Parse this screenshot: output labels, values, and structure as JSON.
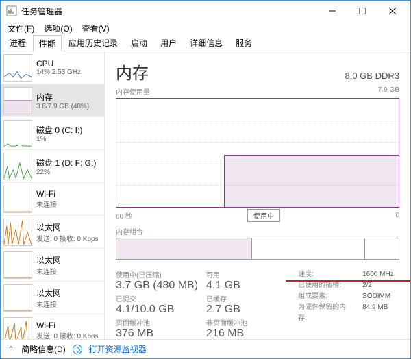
{
  "window": {
    "title": "任务管理器",
    "menu": [
      "文件(F)",
      "选项(O)",
      "查看(V)"
    ],
    "tabs": [
      "进程",
      "性能",
      "应用历史记录",
      "启动",
      "用户",
      "详细信息",
      "服务"
    ],
    "active_tab": "性能",
    "win_buttons": {
      "min": "minimize",
      "max": "maximize",
      "close": "close"
    }
  },
  "sidebar": [
    {
      "title": "CPU",
      "sub": "14% 2.53 GHz",
      "color": "#2a7ab9"
    },
    {
      "title": "内存",
      "sub": "3.8/7.9 GB (48%)",
      "color": "#8b3a8b",
      "selected": true
    },
    {
      "title": "磁盘 0 (C: I:)",
      "sub": "1%",
      "color": "#3a9a3a"
    },
    {
      "title": "磁盘 1 (D: F: G:)",
      "sub": "22%",
      "color": "#3a9a3a"
    },
    {
      "title": "Wi-Fi",
      "sub": "未连接",
      "color": "#c97a1e"
    },
    {
      "title": "以太网",
      "sub": "发送: 0 接收: 0 Kbps",
      "color": "#c97a1e"
    },
    {
      "title": "以太网",
      "sub": "未连接",
      "color": "#c97a1e"
    },
    {
      "title": "以太网",
      "sub": "未连接",
      "color": "#c97a1e"
    },
    {
      "title": "Wi-Fi",
      "sub": "发送: 0 接收: 0 Kbps",
      "color": "#c97a1e"
    }
  ],
  "main": {
    "title": "内存",
    "spec": "8.0 GB DDR3",
    "usage_label": "内存使用量",
    "usage_max": "7.9 GB",
    "x_left": "60 秒",
    "x_right": "0",
    "usage_tag": "使用中",
    "comp_label": "内存组合",
    "stats": {
      "used_label": "使用中(已压缩)",
      "used_value": "3.7 GB (480 MB)",
      "avail_label": "可用",
      "avail_value": "4.1 GB",
      "commit_label": "已提交",
      "commit_value": "4.1/10.0 GB",
      "cached_label": "已缓存",
      "cached_value": "2.7 GB",
      "paged_label": "页面缓冲池",
      "paged_value": "376 MB",
      "nonpaged_label": "非页面缓冲池",
      "nonpaged_value": "216 MB"
    },
    "right": {
      "speed_k": "速度:",
      "speed_v": "1600 MHz",
      "slots_k": "已使用的插槽:",
      "slots_v": "2/2",
      "form_k": "组成要素:",
      "form_v": "SODIMM",
      "hw_k": "为硬件保留的内存:",
      "hw_v": "84.9 MB"
    }
  },
  "footer": {
    "brief": "简略信息(D)",
    "link": "打开资源监视器"
  },
  "chart_data": {
    "type": "area",
    "title": "内存使用量",
    "ylabel": "GB",
    "ylim": [
      0,
      7.9
    ],
    "x_seconds": [
      60,
      0
    ],
    "series": [
      {
        "name": "使用中",
        "approx_value_gb": 3.8,
        "filled_fraction_of_range": 0.48,
        "rises_at_fraction_from_left": 0.38
      }
    ]
  }
}
